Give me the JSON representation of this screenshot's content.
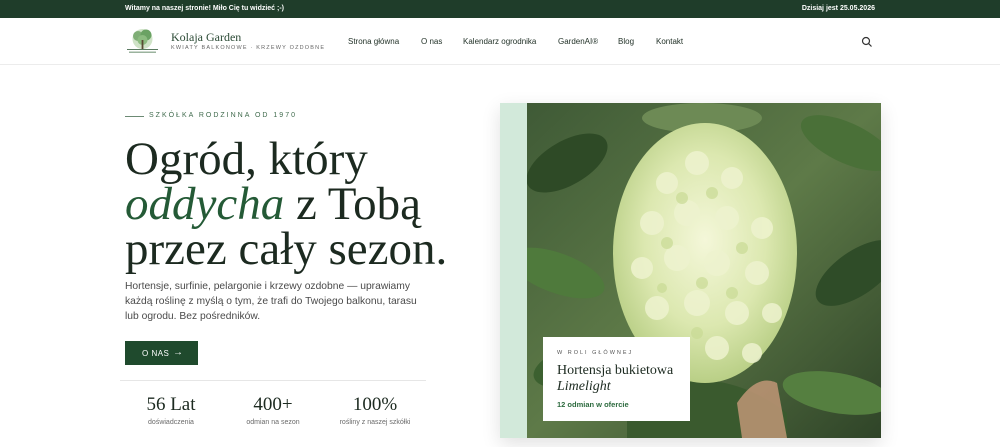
{
  "topbar": {
    "welcome": "Witamy na naszej stronie! Miło Cię tu widzieć ;-)",
    "date": "Dzisiaj jest 25.05.2026"
  },
  "brand": {
    "name": "Kolaja Garden",
    "tagline": "KWIATY BALKONOWE · KRZEWY OZDOBNE",
    "logo_icon": "tree-logo-icon"
  },
  "nav": {
    "items": [
      "Strona główna",
      "O nas",
      "Kalendarz ogrodnika",
      "GardenAI®",
      "Blog",
      "Kontakt"
    ],
    "search_icon": "search-icon"
  },
  "hero": {
    "eyebrow": "SZKÓŁKA RODZINNA OD 1970",
    "line1": "Ogród, który",
    "line2_accent": "oddycha",
    "line2_rest": " z Tobą",
    "line3": "przez cały sezon.",
    "lead": "Hortensje, surfinie, pelargonie i krzewy ozdobne — uprawiamy każdą roślinę z myślą o tym, że trafi do Twojego balkonu, tarasu lub ogrodu. Bez pośredników.",
    "cta_label": "O NAS",
    "cta_arrow": "→"
  },
  "stats": [
    {
      "value": "56 Lat",
      "label": "doświadczenia"
    },
    {
      "value": "400+",
      "label": "odmian na sezon"
    },
    {
      "value": "100%",
      "label": "rośliny z naszej szkółki"
    }
  ],
  "feature": {
    "eyebrow": "W ROLI GŁÓWNEJ",
    "title": "Hortensja bukietowa",
    "subtitle": "Limelight",
    "meta": "12 odmian w ofercie"
  },
  "colors": {
    "topbar": "#1f3d2a",
    "accent": "#245a36",
    "button": "#1f4a2d",
    "photo_frame": "#d2e9da"
  }
}
